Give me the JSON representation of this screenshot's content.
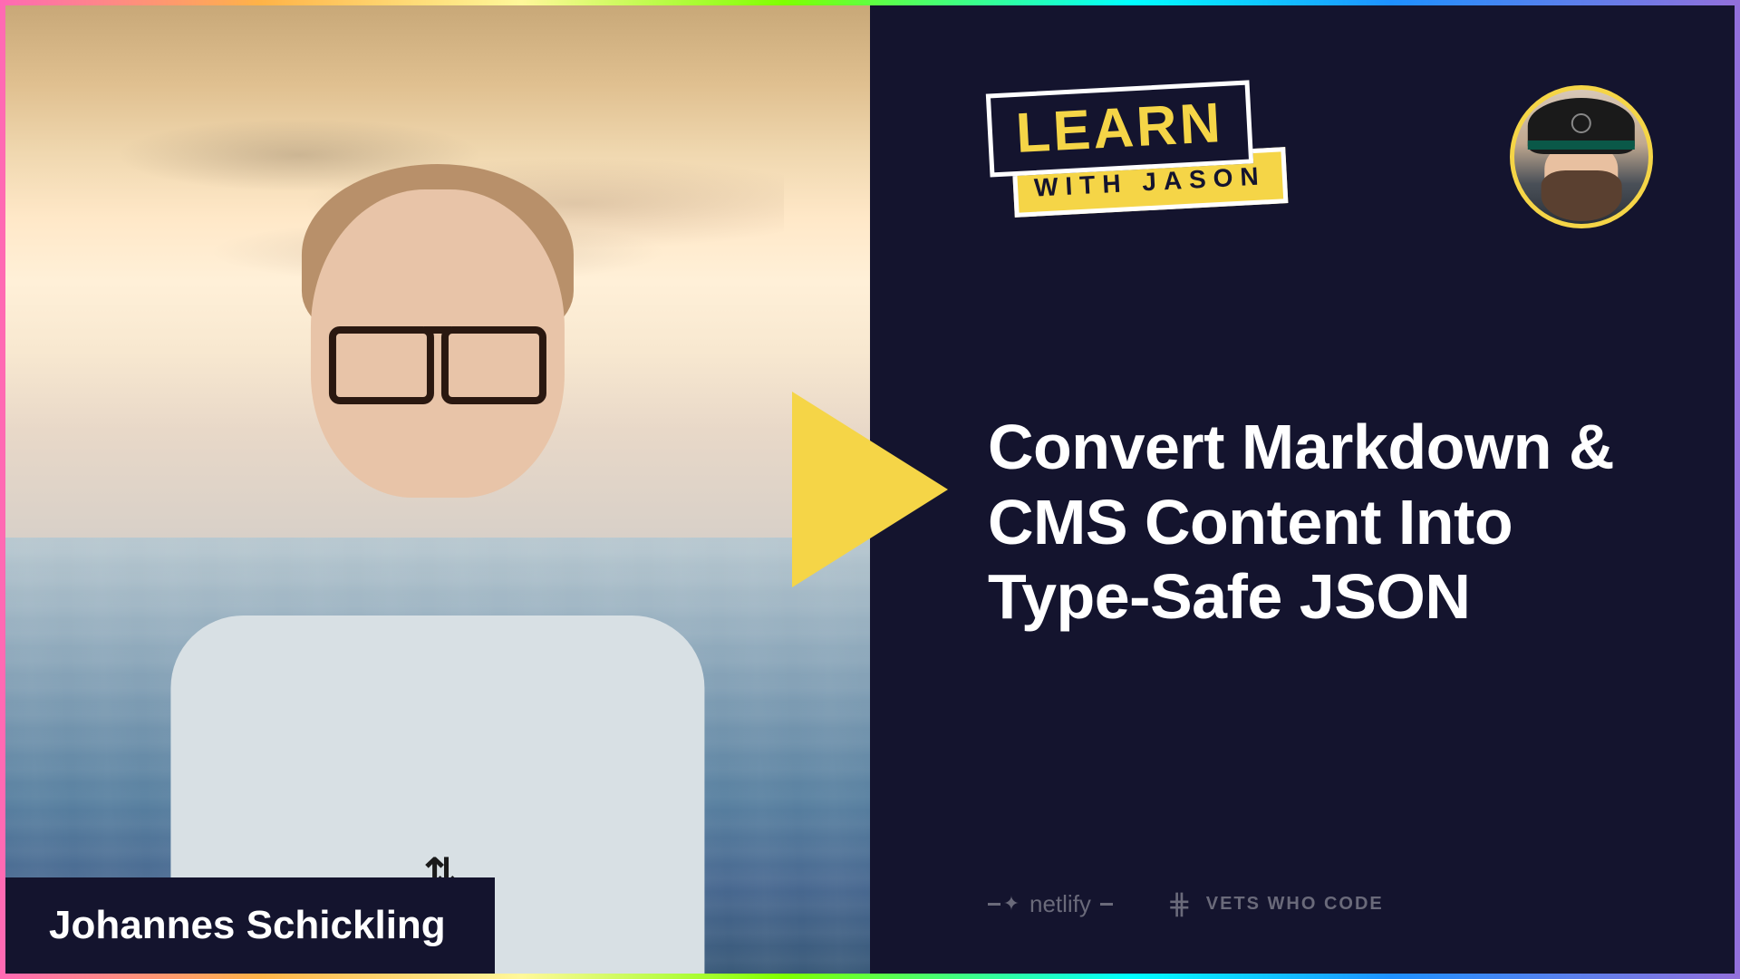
{
  "logo": {
    "learn": "LEARN",
    "with_jason": "WITH JASON"
  },
  "guest": {
    "name": "Johannes Schickling"
  },
  "episode": {
    "title": "Convert Markdown & CMS Content Into Type-Safe JSON"
  },
  "sponsors": {
    "netlify": "netlify",
    "vets_who_code": "VETS WHO CODE"
  },
  "ua_symbol": "⇅"
}
